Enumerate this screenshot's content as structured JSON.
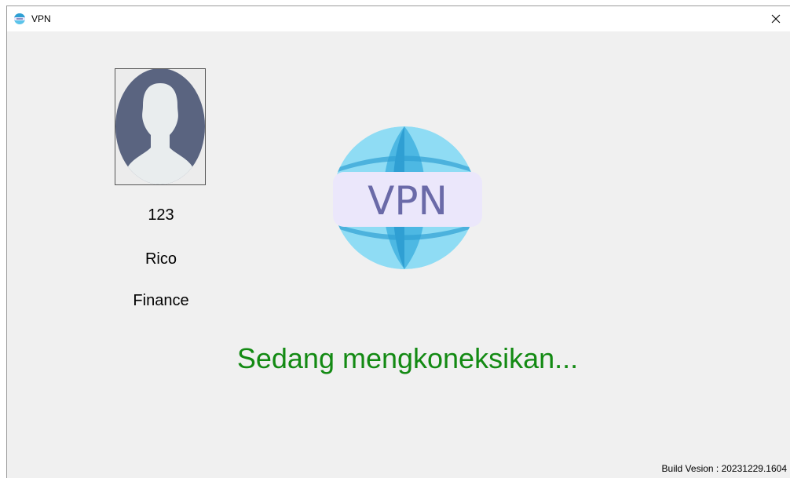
{
  "window": {
    "title": "VPN",
    "close_glyph": "✕"
  },
  "user": {
    "id": "123",
    "name": "Rico",
    "department": "Finance"
  },
  "logo": {
    "text": "VPN",
    "icon": "globe-vpn-icon"
  },
  "status": {
    "message": "Sedang mengkoneksikan...",
    "color": "#138a13"
  },
  "build": {
    "label": "Build Vesion : 20231229.1604"
  },
  "colors": {
    "window_bg": "#f0f0f0",
    "titlebar_bg": "#ffffff",
    "globe_light": "#80d8f3",
    "globe_dark": "#2f9fd3",
    "banner_bg": "#ebe7fb",
    "banner_text": "#6a6aa8",
    "avatar_silhouette": "#5a6480"
  }
}
